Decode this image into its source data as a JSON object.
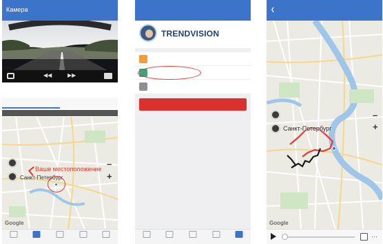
{
  "screen1": {
    "title": "Камера",
    "top_right": "",
    "video_time": "",
    "tabs": [
      "",
      ""
    ],
    "info_line": "",
    "annotation": "Ваше местоположение",
    "city": "Санкт-Петербург",
    "google": "Google",
    "tabbar": [
      "",
      "",
      "",
      "",
      ""
    ]
  },
  "screen2": {
    "back": "",
    "top_right": "",
    "logo_text": "TRENDVISION",
    "profile_right": "",
    "menu": [
      {
        "icon": "wrench-icon",
        "label": "",
        "value": ""
      },
      {
        "icon": "route-icon",
        "label": "",
        "value": ""
      },
      {
        "icon": "settings-icon",
        "label": "",
        "value": ""
      }
    ],
    "logout": "",
    "tabbar": [
      "",
      "",
      "",
      "",
      ""
    ]
  },
  "screen3": {
    "back": "",
    "title": "",
    "top_right": "",
    "city": "Санкт-Петербург",
    "google": "Google",
    "colors": {
      "route_a": "#e23b3b",
      "route_b": "#1a1a1a",
      "river": "#9fc6e8"
    }
  },
  "colors": {
    "accent": "#3b74c8",
    "logout": "#d9312e",
    "annotation": "#e03a2f"
  }
}
